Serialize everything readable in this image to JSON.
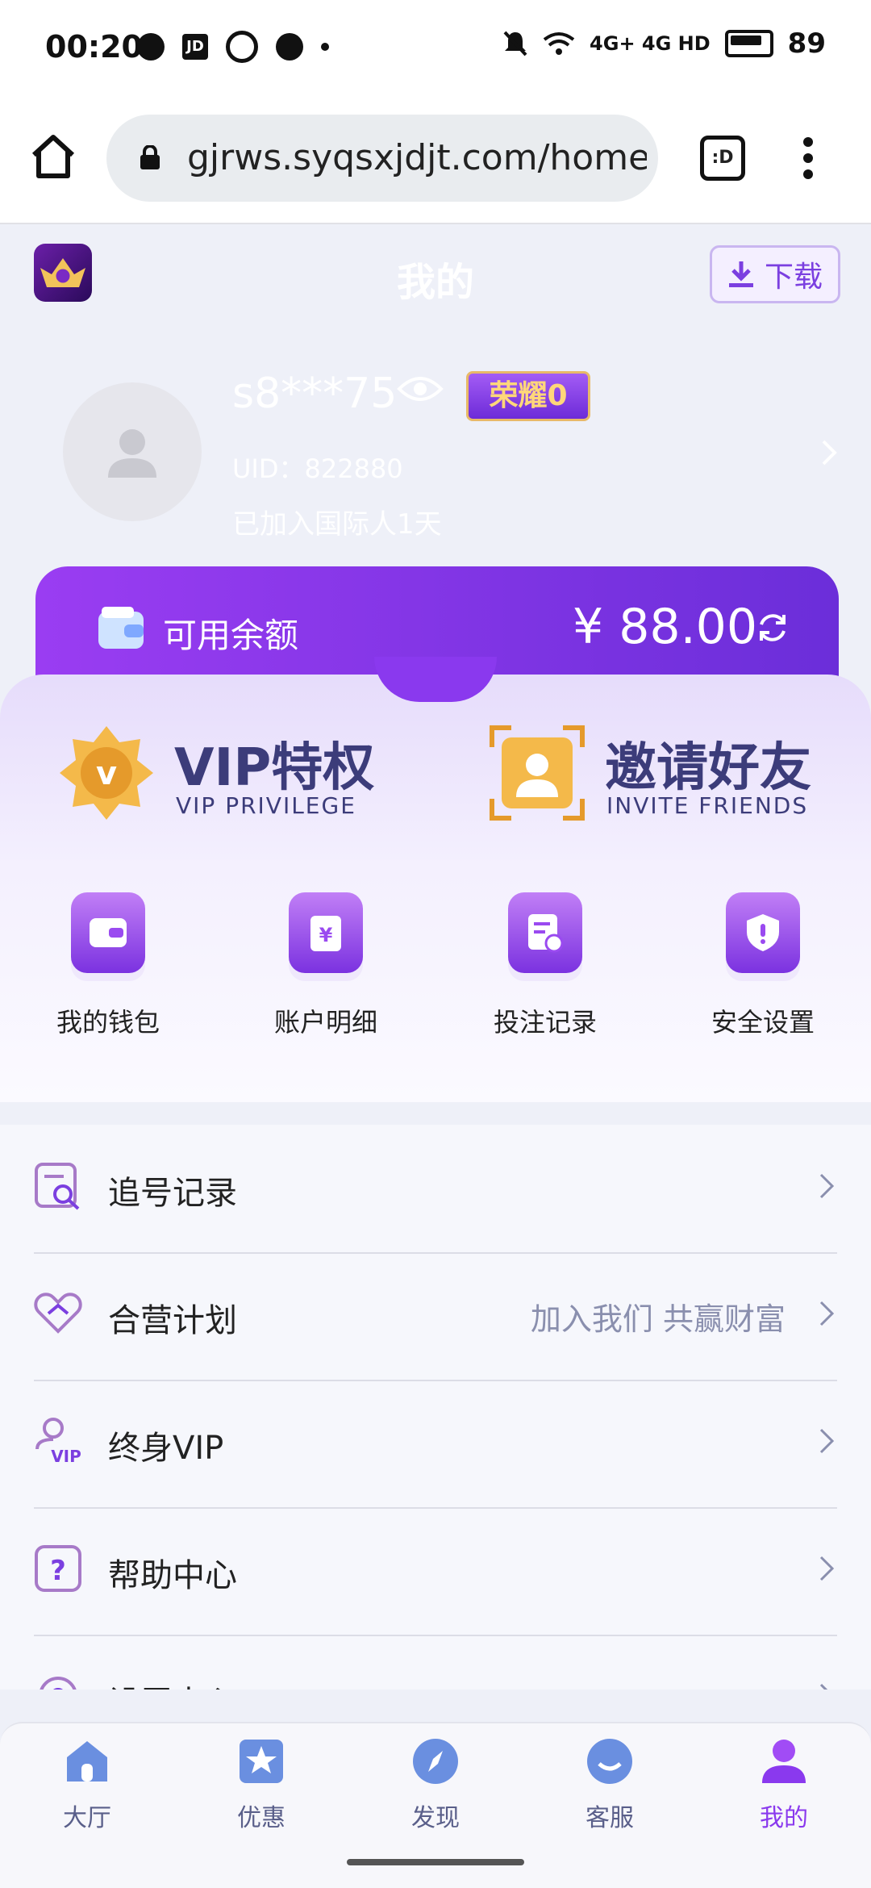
{
  "status_bar": {
    "time": "00:20",
    "network": "4G+ 4G HD",
    "battery": "89"
  },
  "browser": {
    "url": "gjrws.syqsxjdjt.com/home/",
    "tab_label": ":D"
  },
  "header": {
    "title": "我的",
    "download_label": "下载"
  },
  "profile": {
    "username": "s8***75",
    "honor_badge": "荣耀0",
    "uid": "UID：822880",
    "joined": "已加入国际人1天"
  },
  "balance": {
    "label": "可用余额",
    "value": "¥ 88.00"
  },
  "privileges": {
    "vip": {
      "title": "VIP特权",
      "subtitle": "VIP PRIVILEGE"
    },
    "invite": {
      "title": "邀请好友",
      "subtitle": "INVITE FRIENDS"
    }
  },
  "quick_actions": [
    {
      "label": "我的钱包",
      "icon": "wallet-icon"
    },
    {
      "label": "账户明细",
      "icon": "account-detail-icon"
    },
    {
      "label": "投注记录",
      "icon": "bet-record-icon"
    },
    {
      "label": "安全设置",
      "icon": "security-icon"
    }
  ],
  "menu": [
    {
      "label": "追号记录",
      "hint": "",
      "icon": "search-record-icon"
    },
    {
      "label": "合营计划",
      "hint": "加入我们 共赢财富",
      "icon": "handshake-icon"
    },
    {
      "label": "终身VIP",
      "hint": "",
      "icon": "vip-user-icon"
    },
    {
      "label": "帮助中心",
      "hint": "",
      "icon": "help-icon"
    },
    {
      "label": "设置中心",
      "hint": "",
      "icon": "settings-icon"
    }
  ],
  "bottom_nav": [
    {
      "label": "大厅",
      "icon": "lobby-icon"
    },
    {
      "label": "优惠",
      "icon": "promo-icon"
    },
    {
      "label": "发现",
      "icon": "discover-icon"
    },
    {
      "label": "客服",
      "icon": "service-icon"
    },
    {
      "label": "我的",
      "icon": "profile-icon"
    }
  ],
  "colors": {
    "accent": "#8a39ee",
    "card": "#9a3df2",
    "page_bg": "#eef0f8"
  }
}
